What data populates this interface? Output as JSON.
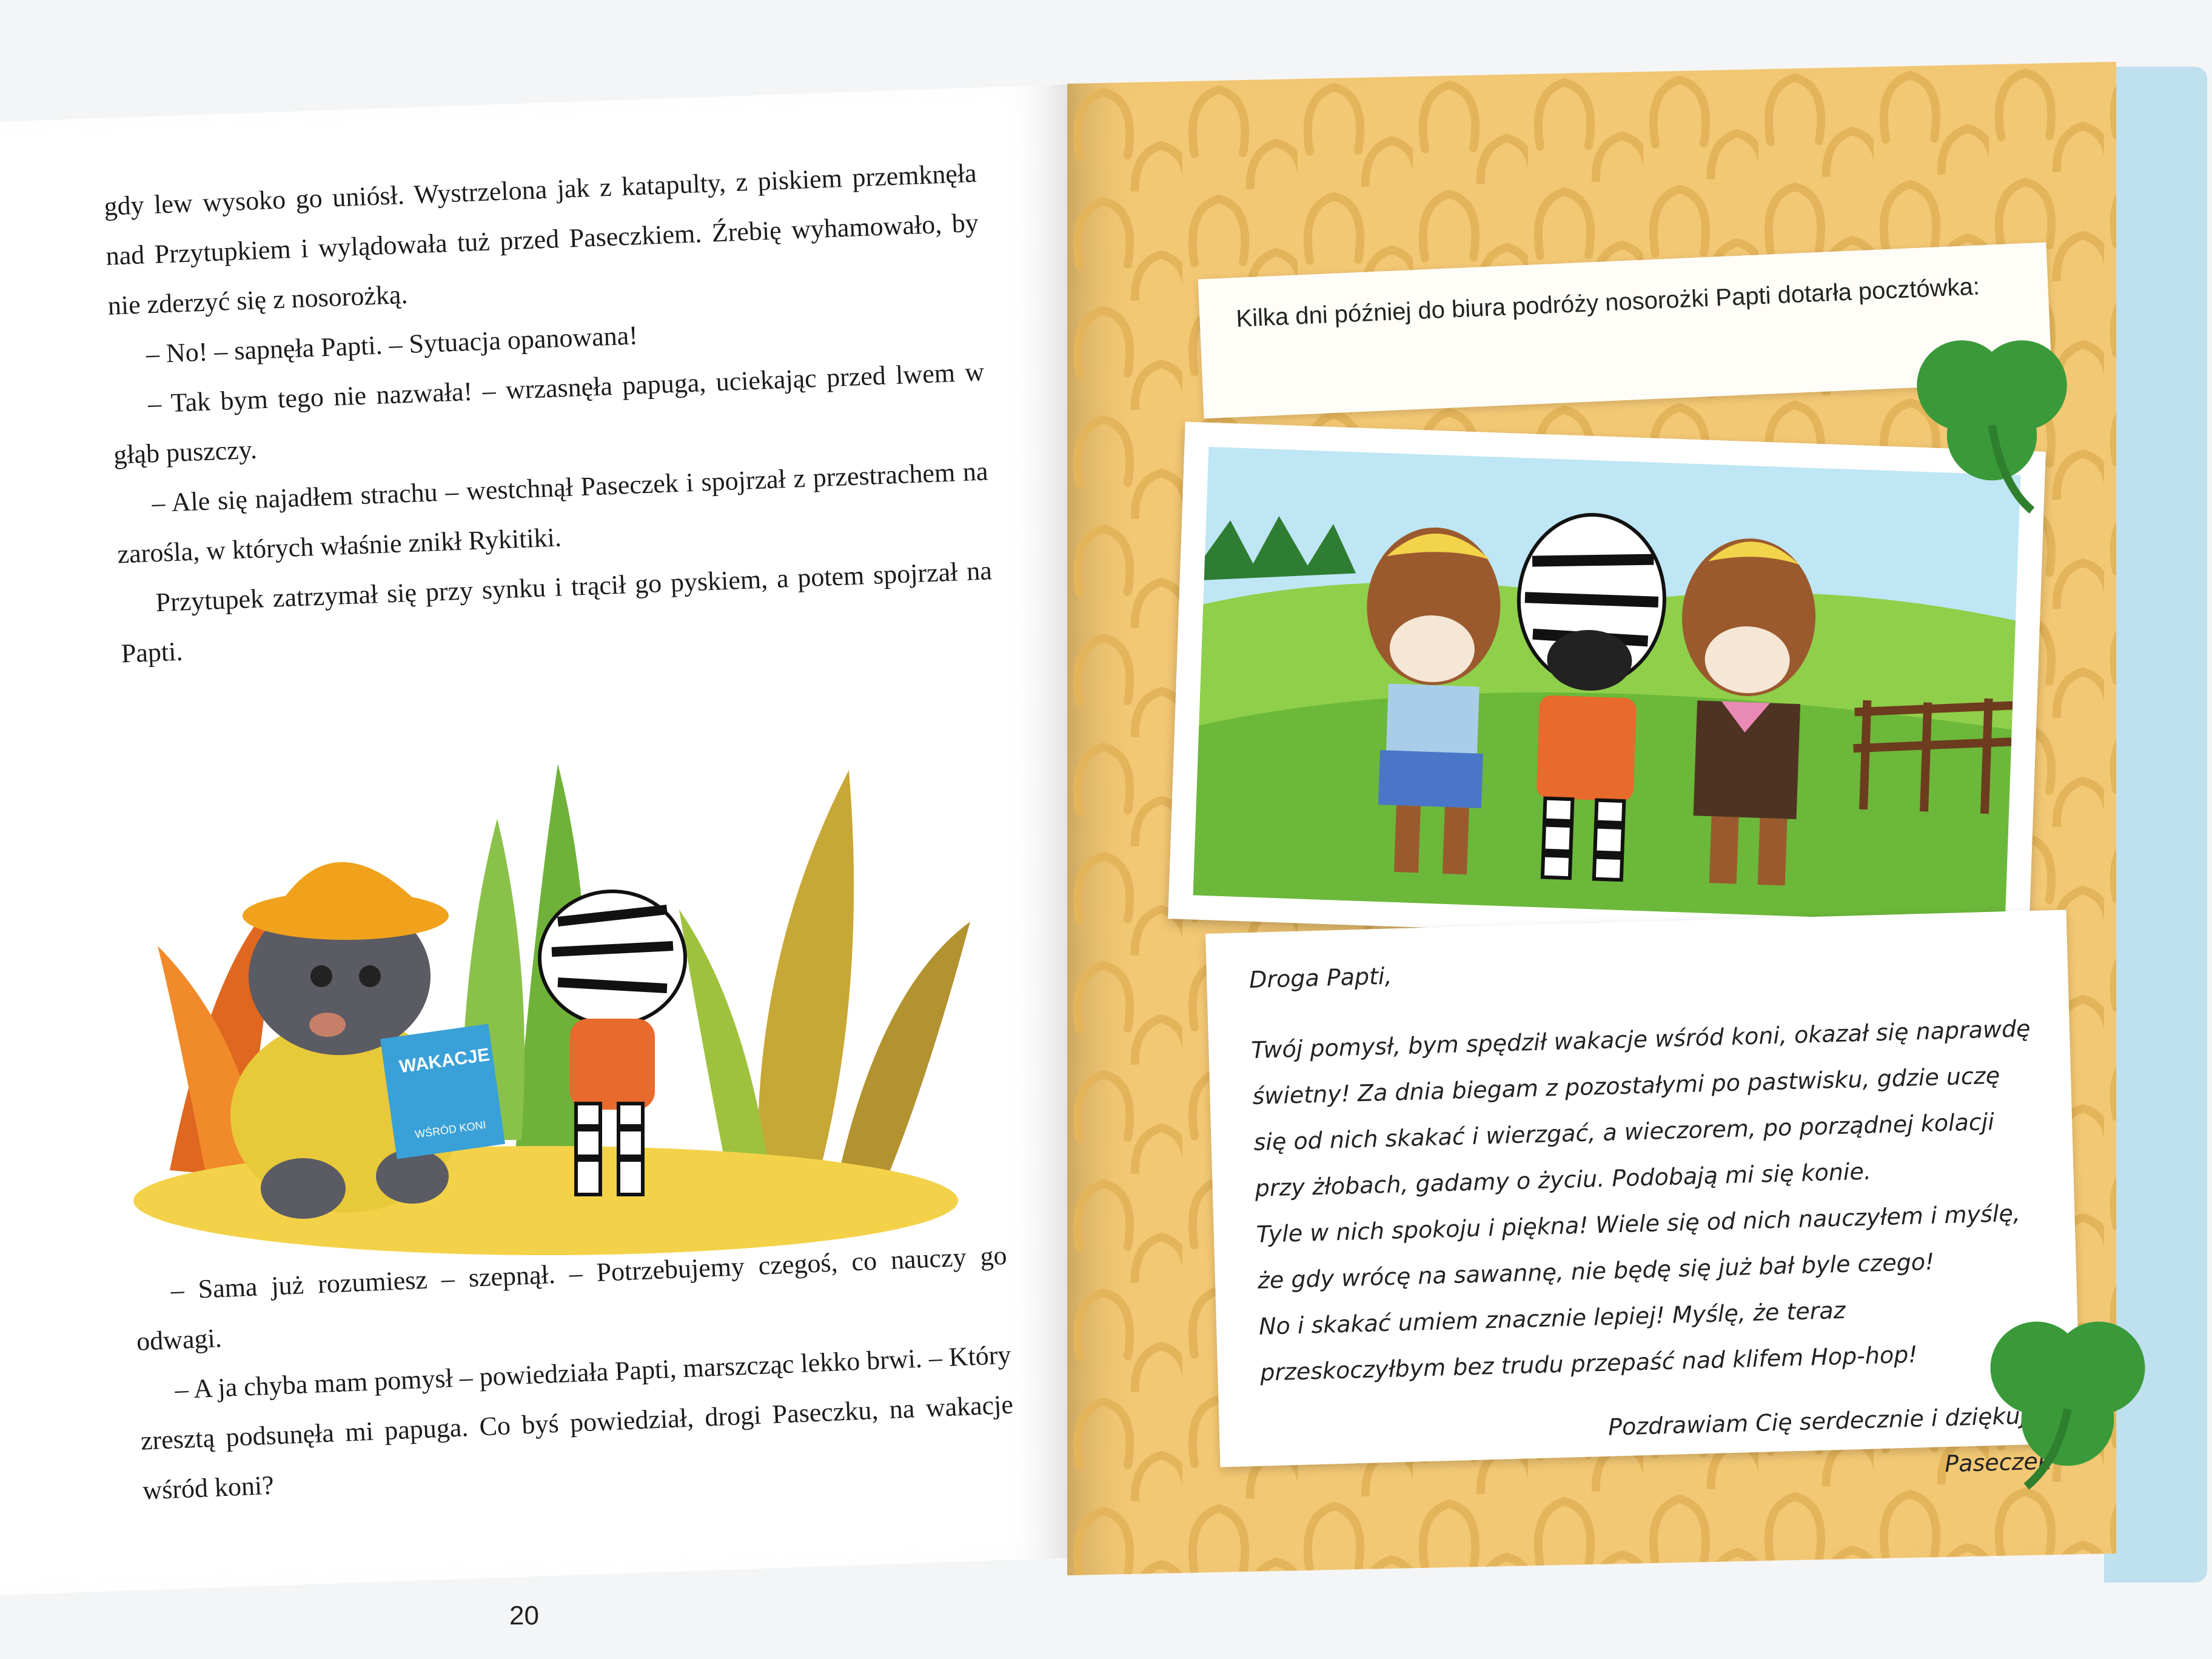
{
  "left_page": {
    "paragraphs": [
      "gdy lew wysoko go uniósł. Wystrzelona jak z katapulty, z piskiem przemknęła nad Przytupkiem i wylądowała tuż przed Paseczkiem. Źrebię wyhamowało, by nie zderzyć się z nosorożką.",
      "– No! – sapnęła Papti. – Sytuacja opanowana!",
      "– Tak bym tego nie nazwała! – wrzasnęła papuga, uciekając przed lwem w głąb puszczy.",
      "– Ale się najadłem strachu – westchnął Paseczek i spojrzał z przestrachem na zarośla, w których właśnie znikł Rykitiki.",
      "Przytupek zatrzymał się przy synku i trącił go pyskiem, a potem spojrzał na Papti."
    ],
    "bottom_paragraphs": [
      "– Sama już rozumiesz – szepnął. – Potrzebujemy czegoś, co nauczy go odwagi.",
      "– A ja chyba mam pomysł – powiedziała Papti, marszcząc lekko brwi. – Który zresztą podsunęła mi papuga. Co byś powiedział, drogi Paseczku, na wakacje wśród koni?"
    ],
    "page_number": "20",
    "illustration": {
      "sign_title": "WAKACJE",
      "sign_subtitle": "WŚRÓD KONI"
    }
  },
  "right_page": {
    "caption": "Kilka dni później do biura podróży nosorożki Papti dotarła pocztówka:",
    "letter": {
      "greeting": "Droga Papti,",
      "lines": [
        "Twój pomysł, bym spędził wakacje wśród koni, okazał się naprawdę",
        "świetny! Za dnia biegam z pozostałymi po pastwisku, gdzie uczę",
        "się od nich skakać i wierzgać, a wieczorem, po porządnej kolacji",
        "przy żłobach, gadamy o życiu. Podobają mi się konie.",
        "Tyle w nich spokoju i piękna! Wiele się od nich nauczyłem i myślę,",
        "że gdy wrócę na sawannę, nie będę się już bał byle czego!",
        "No i skakać umiem znacznie lepiej! Myślę, że teraz",
        "przeskoczyłbym bez trudu przepaść nad klifem Hop-hop!"
      ],
      "closing": "Pozdrawiam Cię serdecznie i dziękuję!",
      "signature": "Paseczek"
    }
  },
  "colors": {
    "right_page_bg": "#f3c874",
    "horseshoe": "#e4b45a",
    "clover": "#3a9a3a",
    "zebra_shirt": "#e86a2c"
  }
}
